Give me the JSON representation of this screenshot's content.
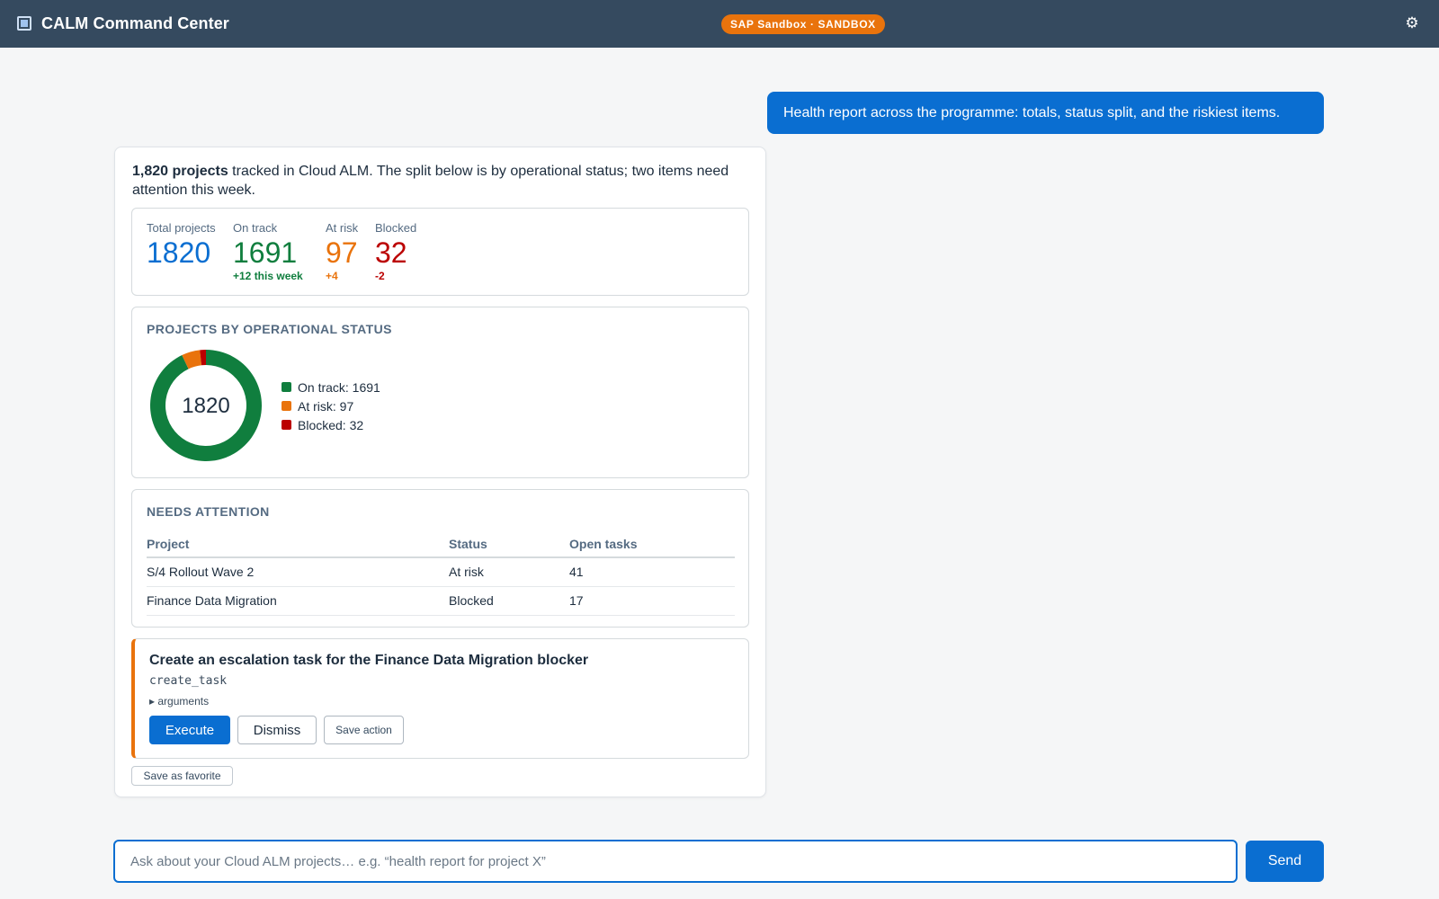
{
  "app": {
    "title": "CALM Command Center",
    "environment_badge": "SAP Sandbox · SANDBOX",
    "settings_icon": "gear-icon",
    "app_icon": "app-window-icon"
  },
  "conversation": {
    "user_message": "Health report across the programme: totals, status split, and the riskiest items.",
    "assistant": {
      "intro_bold": "1,820 projects",
      "intro_rest": " tracked in Cloud ALM. The split below is by operational status; two items need attention this week.",
      "kpis": [
        {
          "label": "Total projects",
          "value": "1820",
          "delta": "",
          "color": "#0a6ed1"
        },
        {
          "label": "On track",
          "value": "1691",
          "delta": "+12 this week",
          "color": "#107e3e"
        },
        {
          "label": "At risk",
          "value": "97",
          "delta": "+4",
          "color": "#e9730c"
        },
        {
          "label": "Blocked",
          "value": "32",
          "delta": "-2",
          "color": "#bb0000"
        }
      ],
      "chart_section_title": "PROJECTS BY OPERATIONAL STATUS",
      "chart_data": {
        "type": "pie",
        "title": "PROJECTS BY OPERATIONAL STATUS",
        "center_label": "1820",
        "categories": [
          "On track",
          "At risk",
          "Blocked"
        ],
        "values": [
          1691,
          97,
          32
        ],
        "colors": [
          "#107e3e",
          "#e9730c",
          "#bb0000"
        ],
        "legend": [
          "On track: 1691",
          "At risk: 97",
          "Blocked: 32"
        ],
        "legend_position": "right"
      },
      "attention_section_title": "NEEDS ATTENTION",
      "attention_table": {
        "headers": [
          "Project",
          "Status",
          "Open tasks"
        ],
        "rows": [
          [
            "S/4 Rollout Wave 2",
            "At risk",
            "41"
          ],
          [
            "Finance Data Migration",
            "Blocked",
            "17"
          ]
        ]
      },
      "action": {
        "title": "Create an escalation task for the Finance Data Migration blocker",
        "function_name": "create_task",
        "arguments_toggle": "arguments",
        "execute_label": "Execute",
        "dismiss_label": "Dismiss",
        "save_action_label": "Save action",
        "accent_color": "#e9730c"
      },
      "save_favorite_label": "Save as favorite"
    }
  },
  "composer": {
    "placeholder": "Ask about your Cloud ALM projects… e.g. “health report for project X”",
    "value": "",
    "send_label": "Send"
  }
}
